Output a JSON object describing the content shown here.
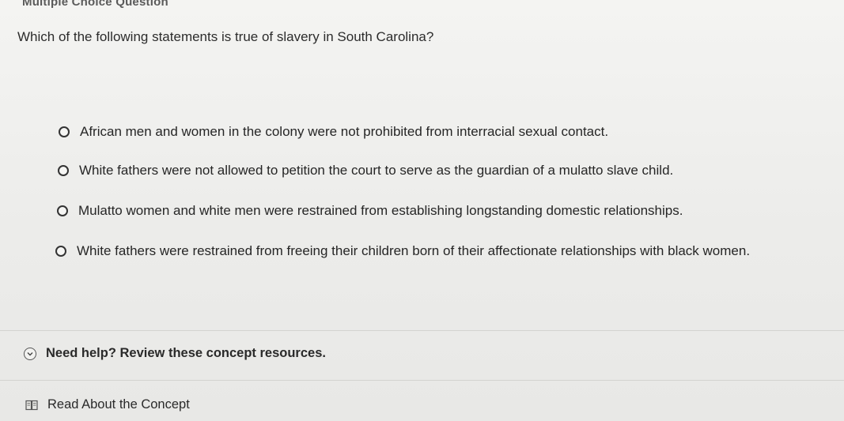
{
  "header": {
    "title": "Multiple Choice Question"
  },
  "question": {
    "text": "Which of the following statements is true of slavery in South Carolina?"
  },
  "options": [
    {
      "label": "African men and women in the colony were not prohibited from interracial sexual contact."
    },
    {
      "label": "White fathers were not allowed to petition the court to serve as the guardian of a mulatto slave child."
    },
    {
      "label": "Mulatto women and white men were restrained from establishing longstanding domestic relationships."
    },
    {
      "label": "White fathers were restrained from freeing their children born of their affectionate relationships with black women."
    }
  ],
  "help": {
    "label": "Need help? Review these concept resources.",
    "icon": "chevron-down-icon"
  },
  "resources": [
    {
      "label": "Read About the Concept",
      "icon": "book-icon"
    }
  ]
}
